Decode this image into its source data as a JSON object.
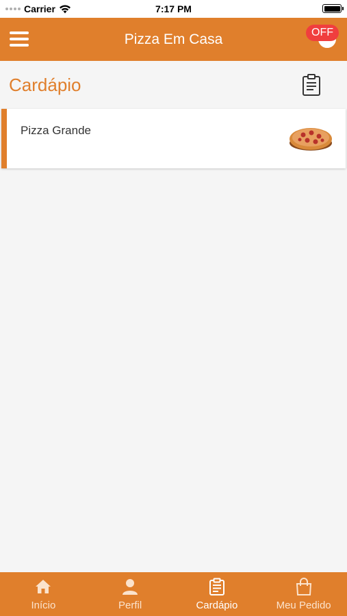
{
  "status_bar": {
    "carrier": "Carrier",
    "time": "7:17 PM"
  },
  "header": {
    "title": "Pizza Em Casa",
    "badge": "OFF"
  },
  "section": {
    "title": "Cardápio"
  },
  "menu": {
    "items": [
      {
        "name": "Pizza Grande",
        "icon": "pizza-image"
      }
    ]
  },
  "tabs": [
    {
      "label": "Início",
      "icon": "home-icon",
      "active": false
    },
    {
      "label": "Perfil",
      "icon": "person-icon",
      "active": false
    },
    {
      "label": "Cardápio",
      "icon": "clipboard-icon",
      "active": true
    },
    {
      "label": "Meu Pedido",
      "icon": "bag-icon",
      "active": false
    }
  ],
  "colors": {
    "primary": "#e07f2c",
    "badge": "#f03e3e",
    "background": "#f5f5f5"
  }
}
